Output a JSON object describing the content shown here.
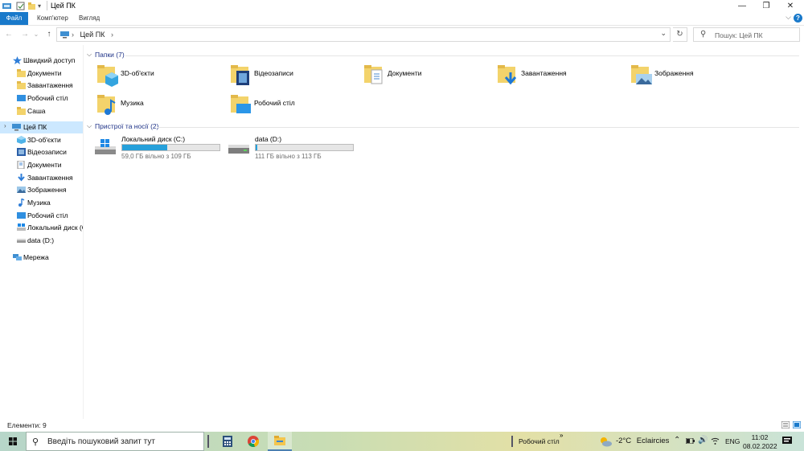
{
  "window": {
    "title": "Цей ПК",
    "minimize": "—",
    "maximize": "❐",
    "close": "✕"
  },
  "ribbon": {
    "tabs": [
      "Файл",
      "Комп'ютер",
      "Вигляд"
    ],
    "help": "?",
    "collapse": "⌵"
  },
  "address": {
    "back": "←",
    "forward": "→",
    "recent": "⌄",
    "up": "↑",
    "path": "Цей ПК",
    "separator": "›",
    "dropdown": "⌄",
    "refresh": "↻",
    "search_placeholder": "Пошук: Цей ПК"
  },
  "sidebar": {
    "items": [
      {
        "label": "Швидкий доступ",
        "icon": "star-icon"
      },
      {
        "label": "Документи",
        "icon": "folder-icon"
      },
      {
        "label": "Завантаження",
        "icon": "folder-icon"
      },
      {
        "label": "Робочий стіл",
        "icon": "desktop-icon"
      },
      {
        "label": "Саша",
        "icon": "folder-icon"
      },
      {
        "label": "Цей ПК",
        "icon": "computer-icon"
      },
      {
        "label": "3D-об'єкти",
        "icon": "3d-objects-icon"
      },
      {
        "label": "Відеозаписи",
        "icon": "videos-icon"
      },
      {
        "label": "Документи",
        "icon": "documents-icon"
      },
      {
        "label": "Завантаження",
        "icon": "downloads-icon"
      },
      {
        "label": "Зображення",
        "icon": "pictures-icon"
      },
      {
        "label": "Музика",
        "icon": "music-icon"
      },
      {
        "label": "Робочий стіл",
        "icon": "desktop-icon"
      },
      {
        "label": "Локальний диск (C",
        "icon": "windows-drive-icon"
      },
      {
        "label": "data (D:)",
        "icon": "drive-icon"
      },
      {
        "label": "Мережа",
        "icon": "network-icon"
      }
    ]
  },
  "folders_group": {
    "title": "Папки (7)",
    "items": [
      {
        "label": "3D-об'єкти",
        "icon": "3d-objects-folder-icon"
      },
      {
        "label": "Відеозаписи",
        "icon": "videos-folder-icon"
      },
      {
        "label": "Документи",
        "icon": "documents-folder-icon"
      },
      {
        "label": "Завантаження",
        "icon": "downloads-folder-icon"
      },
      {
        "label": "Зображення",
        "icon": "pictures-folder-icon"
      },
      {
        "label": "Музика",
        "icon": "music-folder-icon"
      },
      {
        "label": "Робочий стіл",
        "icon": "desktop-folder-icon"
      }
    ]
  },
  "devices_group": {
    "title": "Пристрої та носії (2)",
    "drives": [
      {
        "label": "Локальний диск (C:)",
        "free": "59,0 ГБ вільно з 109 ГБ",
        "used_fraction": 0.46,
        "icon": "windows-drive-icon"
      },
      {
        "label": "data (D:)",
        "free": "111 ГБ вільно з 113 ГБ",
        "used_fraction": 0.02,
        "icon": "drive-icon"
      }
    ]
  },
  "status": {
    "text": "Елементи: 9"
  },
  "taskbar": {
    "search_placeholder": "Введіть пошуковий запит тут",
    "desktop_label": "Робочий стіл",
    "toolbar_arrow": "»",
    "temperature": "-2°C",
    "weather": "Eclaircies",
    "language": "ENG",
    "time": "11:02",
    "date": "08.02.2022"
  },
  "colors": {
    "accent": "#1979ca",
    "selection": "#cce8ff",
    "drive_fill": "#26a0da",
    "group_header": "#1e3287"
  }
}
